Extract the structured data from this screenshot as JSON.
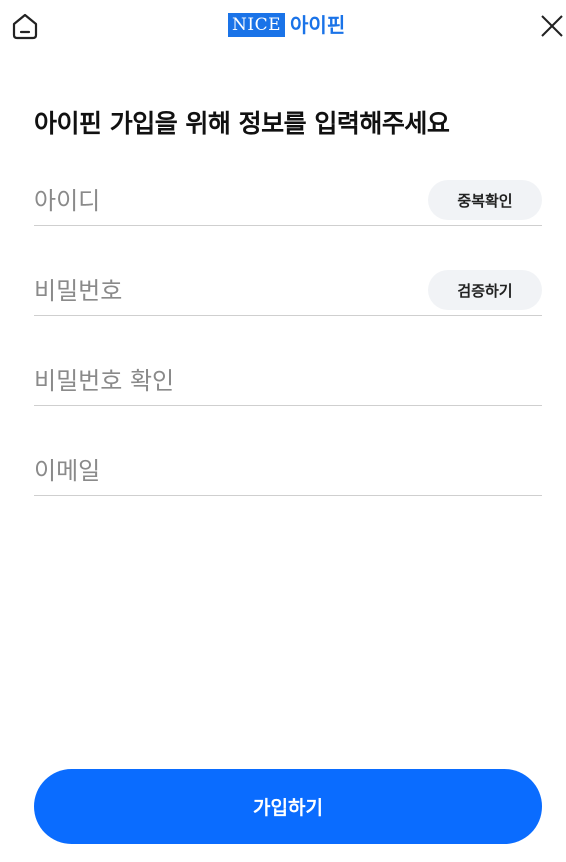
{
  "header": {
    "logo_brand": "NICE",
    "logo_product": "아이핀",
    "home_icon": "home-icon",
    "close_icon": "close-icon"
  },
  "title": "아이핀 가입을 위해 정보를 입력해주세요",
  "form": {
    "id_placeholder": "아이디",
    "id_check_label": "중복확인",
    "password_placeholder": "비밀번호",
    "password_verify_label": "검증하기",
    "password_confirm_placeholder": "비밀번호 확인",
    "email_placeholder": "이메일"
  },
  "submit_label": "가입하기",
  "colors": {
    "brand_blue": "#1a73e8",
    "primary_button": "#0a6cff",
    "secondary_button_bg": "#f1f3f6",
    "divider": "#cfcfcf",
    "placeholder": "#8a8a8a"
  }
}
